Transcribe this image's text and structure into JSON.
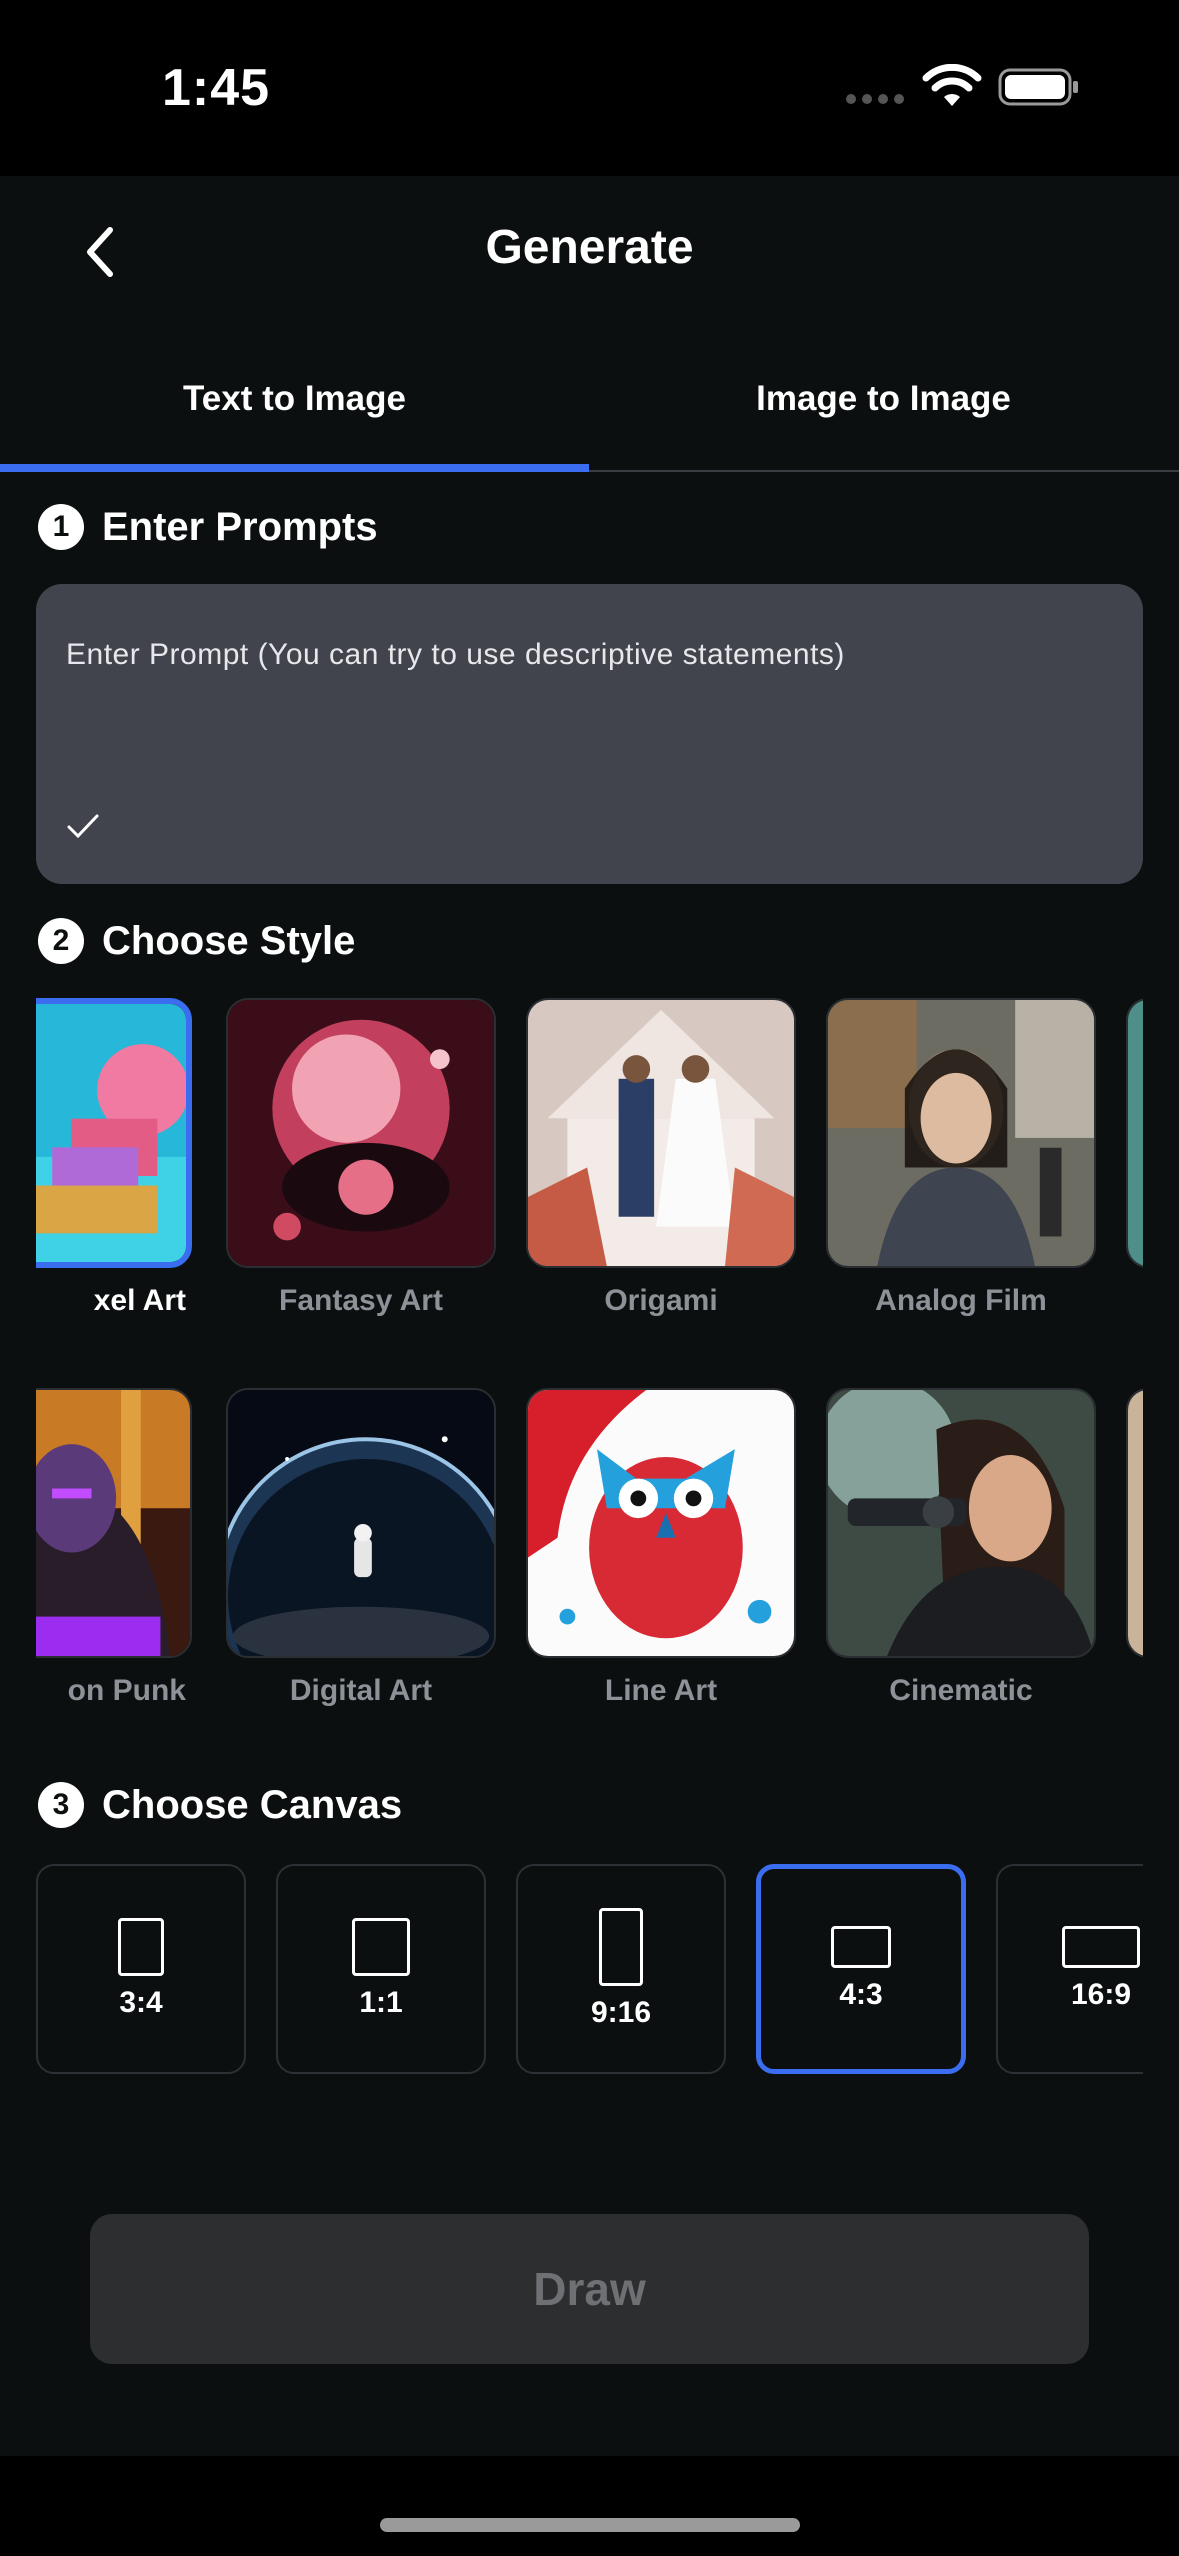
{
  "status": {
    "time": "1:45"
  },
  "nav": {
    "title": "Generate"
  },
  "tabs": [
    {
      "label": "Text to Image",
      "active": true
    },
    {
      "label": "Image to Image",
      "active": false
    }
  ],
  "sections": {
    "prompts": {
      "num": "1",
      "title": "Enter Prompts"
    },
    "style": {
      "num": "2",
      "title": "Choose Style"
    },
    "canvas": {
      "num": "3",
      "title": "Choose Canvas"
    }
  },
  "prompt": {
    "placeholder": "Enter Prompt (You can try to use descriptive statements)"
  },
  "styles_row1": [
    {
      "label": "xel Art",
      "selected": true
    },
    {
      "label": "Fantasy Art",
      "selected": false
    },
    {
      "label": "Origami",
      "selected": false
    },
    {
      "label": "Analog Film",
      "selected": false
    }
  ],
  "styles_row2": [
    {
      "label": "on Punk",
      "selected": false
    },
    {
      "label": "Digital Art",
      "selected": false
    },
    {
      "label": "Line Art",
      "selected": false
    },
    {
      "label": "Cinematic",
      "selected": false
    }
  ],
  "canvases": [
    {
      "label": "3:4",
      "selected": false
    },
    {
      "label": "1:1",
      "selected": false
    },
    {
      "label": "9:16",
      "selected": false
    },
    {
      "label": "4:3",
      "selected": true
    },
    {
      "label": "16:9",
      "selected": false
    }
  ],
  "draw": {
    "label": "Draw"
  },
  "colors": {
    "accent": "#3a6df0",
    "background": "#0b0f0f",
    "prompt_bg": "#41444d"
  }
}
